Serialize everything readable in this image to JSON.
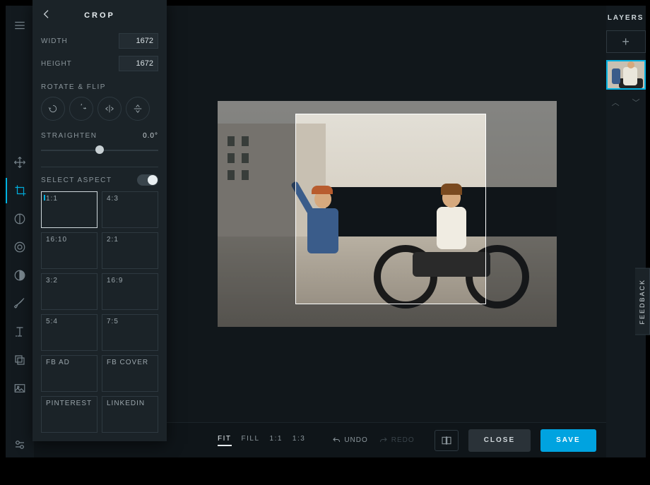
{
  "panel": {
    "title": "CROP",
    "width_label": "WIDTH",
    "width_value": "1672",
    "height_label": "HEIGHT",
    "height_value": "1672",
    "rotate_flip_label": "ROTATE & FLIP",
    "straighten_label": "STRAIGHTEN",
    "straighten_value": "0.0°",
    "select_aspect_label": "SELECT ASPECT",
    "aspects": [
      "1:1",
      "4:3",
      "16:10",
      "2:1",
      "3:2",
      "16:9",
      "5:4",
      "7:5",
      "FB AD",
      "FB COVER",
      "PINTEREST",
      "LINKEDIN"
    ]
  },
  "bottombar": {
    "zoom": [
      "FIT",
      "FILL",
      "1:1",
      "1:3"
    ],
    "undo": "UNDO",
    "redo": "REDO",
    "close": "CLOSE",
    "save": "SAVE"
  },
  "layers": {
    "title": "LAYERS",
    "add": "+",
    "up": "︿",
    "down": "﹀"
  },
  "feedback": "FEEDBACK"
}
